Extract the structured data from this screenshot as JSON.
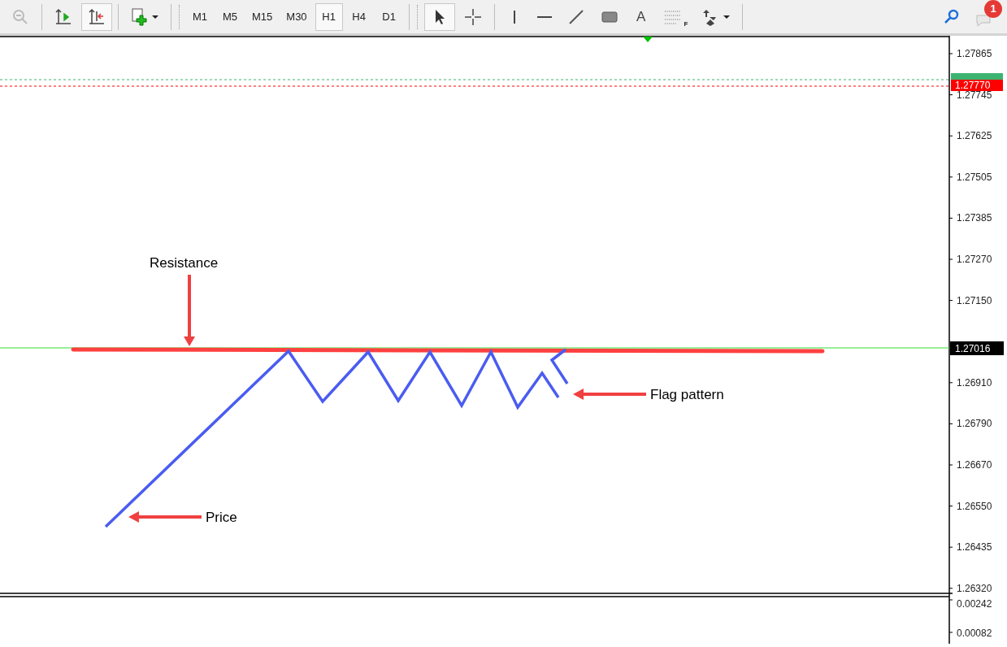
{
  "toolbar": {
    "left": [
      {
        "kind": "zoom-out",
        "disabled": true
      },
      {
        "kind": "sep"
      },
      {
        "kind": "chart-shift",
        "selected": false
      },
      {
        "kind": "autoscroll",
        "selected": true
      },
      {
        "kind": "sep"
      },
      {
        "kind": "new-chart"
      },
      {
        "kind": "sep"
      }
    ],
    "timeframes": [
      {
        "label": "M1",
        "selected": false
      },
      {
        "label": "M5",
        "selected": false
      },
      {
        "label": "M15",
        "selected": false
      },
      {
        "label": "M30",
        "selected": false
      },
      {
        "label": "H1",
        "selected": true
      },
      {
        "label": "H4",
        "selected": false
      },
      {
        "label": "D1",
        "selected": false
      }
    ],
    "tools": [
      {
        "kind": "cursor",
        "selected": true
      },
      {
        "kind": "crosshair",
        "selected": false
      },
      {
        "kind": "sep"
      },
      {
        "kind": "vline"
      },
      {
        "kind": "hline"
      },
      {
        "kind": "trendline"
      },
      {
        "kind": "rectangle"
      },
      {
        "kind": "text",
        "text": "A"
      },
      {
        "kind": "fibo",
        "text": "F"
      },
      {
        "kind": "arrows"
      }
    ],
    "notifications": {
      "count": "1"
    }
  },
  "chart": {
    "price_ticks": [
      "1.27865",
      "1.27745",
      "1.27625",
      "1.27505",
      "1.27385",
      "1.27270",
      "1.27150",
      "1.26910",
      "1.26790",
      "1.26670",
      "1.26550",
      "1.26435",
      "1.26320"
    ],
    "ask_tag": {
      "color": "#3cb371"
    },
    "bid_tag": {
      "text": "1.27770",
      "color": "#ff0000"
    },
    "current_tag": {
      "text": "1.27016"
    },
    "annotations": [
      {
        "kind": "down",
        "text": "Resistance"
      },
      {
        "kind": "left",
        "text": "Flag pattern"
      },
      {
        "kind": "left",
        "text": "Price"
      }
    ]
  },
  "indicator": {
    "ticks": [
      "0.00242",
      "0.00082"
    ]
  }
}
